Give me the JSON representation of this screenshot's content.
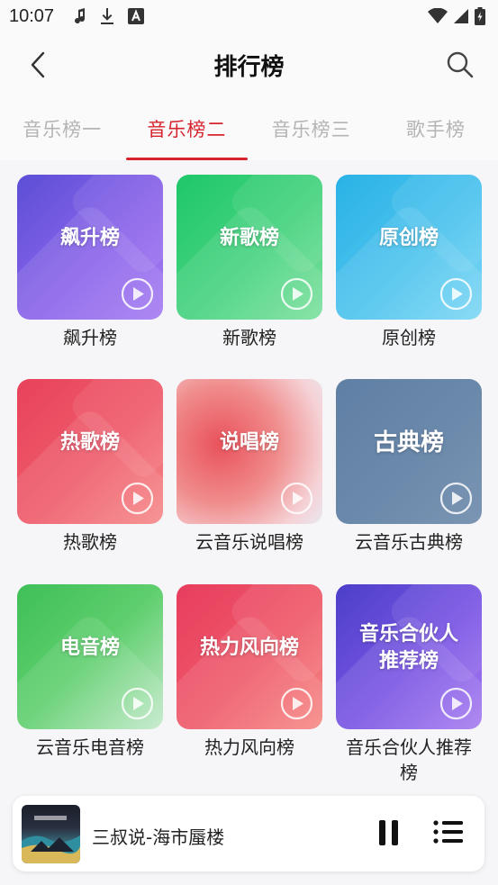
{
  "status": {
    "time": "10:07"
  },
  "header": {
    "title": "排行榜"
  },
  "tabs": [
    {
      "label": "音乐榜一",
      "active": false
    },
    {
      "label": "音乐榜二",
      "active": true
    },
    {
      "label": "音乐榜三",
      "active": false
    },
    {
      "label": "歌手榜",
      "active": false
    }
  ],
  "charts": [
    {
      "cover_title": "飙升榜",
      "label": "飙升榜"
    },
    {
      "cover_title": "新歌榜",
      "label": "新歌榜"
    },
    {
      "cover_title": "原创榜",
      "label": "原创榜"
    },
    {
      "cover_title": "热歌榜",
      "label": "热歌榜"
    },
    {
      "cover_title": "说唱榜",
      "label": "云音乐说唱榜"
    },
    {
      "cover_title": "古典榜",
      "label": "云音乐古典榜"
    },
    {
      "cover_title": "电音榜",
      "label": "云音乐电音榜"
    },
    {
      "cover_title": "热力风向榜",
      "label": "热力风向榜"
    },
    {
      "cover_title": "音乐合伙人推荐榜",
      "label": "音乐合伙人推荐榜"
    }
  ],
  "player": {
    "song": "三叔说-海市蜃楼",
    "state": "playing"
  },
  "colors": {
    "accent": "#d6232c"
  }
}
